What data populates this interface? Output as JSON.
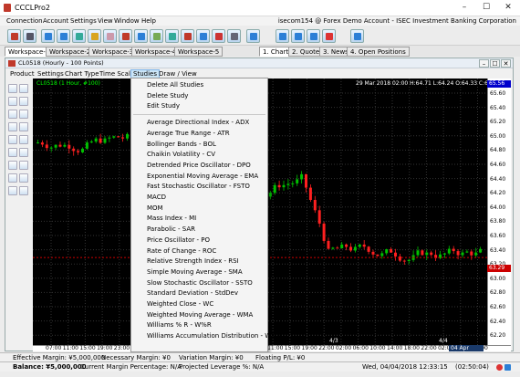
{
  "window": {
    "title": "CCCLPro2",
    "minimize": "–",
    "maximize": "☐",
    "close": "✕"
  },
  "menubar": {
    "items": [
      "Connection",
      "Account",
      "Settings",
      "View",
      "Window",
      "Help"
    ],
    "account_info": "isecom154 @ Forex Demo Account - ISEC Investment Banking Corporation"
  },
  "workspace_tabs": [
    "Workspace-1",
    "Workspace-2",
    "Workspace-3",
    "Workspace-4",
    "Workspace-5"
  ],
  "view_tabs": [
    "1. Chart",
    "2. Quote",
    "3. News",
    "4. Open Positions"
  ],
  "chart_window": {
    "title": "CL0518 (Hourly - 100 Points)",
    "menu": [
      "Product",
      "Settings",
      "Chart Type",
      "Time Scale",
      "Studies",
      "Draw / View"
    ],
    "open_menu": "Studies",
    "symbol_label": "CL0518 (1 Hour, #100)",
    "ohlc": "29 Mar 2018 02:00 H:64.71 L:64.24 O:64.33 C:64.56",
    "header_price": "65.56",
    "last_price": "63.29",
    "date_badge": "04 Apr 12:00",
    "axis_markers": [
      "4/3",
      "4/4"
    ]
  },
  "price_axis": [
    "65.60",
    "65.40",
    "65.20",
    "65.00",
    "64.80",
    "64.60",
    "64.40",
    "64.20",
    "64.00",
    "63.80",
    "63.60",
    "63.40",
    "63.20",
    "63.00",
    "62.80",
    "62.60",
    "62.40",
    "62.20"
  ],
  "time_axis": [
    "07:00",
    "11:00",
    "15:00",
    "19:00",
    "23:00",
    "03:00",
    "07:00",
    "11:00",
    "15:00",
    "19:00",
    "23:00",
    "03:00",
    "07:00",
    "11:00",
    "15:00",
    "19:00",
    "22:00",
    "02:00",
    "06:00",
    "10:00",
    "14:00",
    "18:00",
    "22:00",
    "02:00",
    "06:00",
    "10:00"
  ],
  "studies_menu": {
    "group1": [
      "Delete All Studies",
      "Delete Study",
      "Edit Study"
    ],
    "group2": [
      "Average Directional Index - ADX",
      "Average True Range - ATR",
      "Bollinger Bands - BOL",
      "Chaikin Volatility - CV",
      "Detrended Price Oscillator - DPO",
      "Exponential Moving Average - EMA",
      "Fast Stochastic Oscillator - FSTO",
      "MACD",
      "MOM",
      "Mass Index - MI",
      "Parabolic - SAR",
      "Price Oscillator - PO",
      "Rate of Change - ROC",
      "Relative Strength Index - RSI",
      "Simple Moving Average - SMA",
      "Slow Stochastic Oscillator - SSTO",
      "Standard Deviation - StdDev",
      "Weighted Close - WC",
      "Weighted Moving Average - WMA",
      "Williams % R - W%R",
      "Williams Accumulation Distribution - WAD"
    ]
  },
  "status": {
    "effective_margin": "Effective Margin: ¥5,000,000",
    "necessary_margin": "Necessary Margin: ¥0",
    "variation_margin": "Variation Margin: ¥0",
    "floating_pl": "Floating P/L: ¥0",
    "balance": "Balance: ¥5,000,000",
    "current_margin_pct": "Current Margin Percentage: N/A",
    "projected_leverage": "Projected Leverage %: N/A",
    "datetime": "Wed, 04/04/2018 12:33:15",
    "clock": "(02:50:04)"
  },
  "colors": {
    "up": "#00c000",
    "down": "#ff2020",
    "plot_bg": "#000000",
    "menu_highlight": "#cde6f7"
  }
}
